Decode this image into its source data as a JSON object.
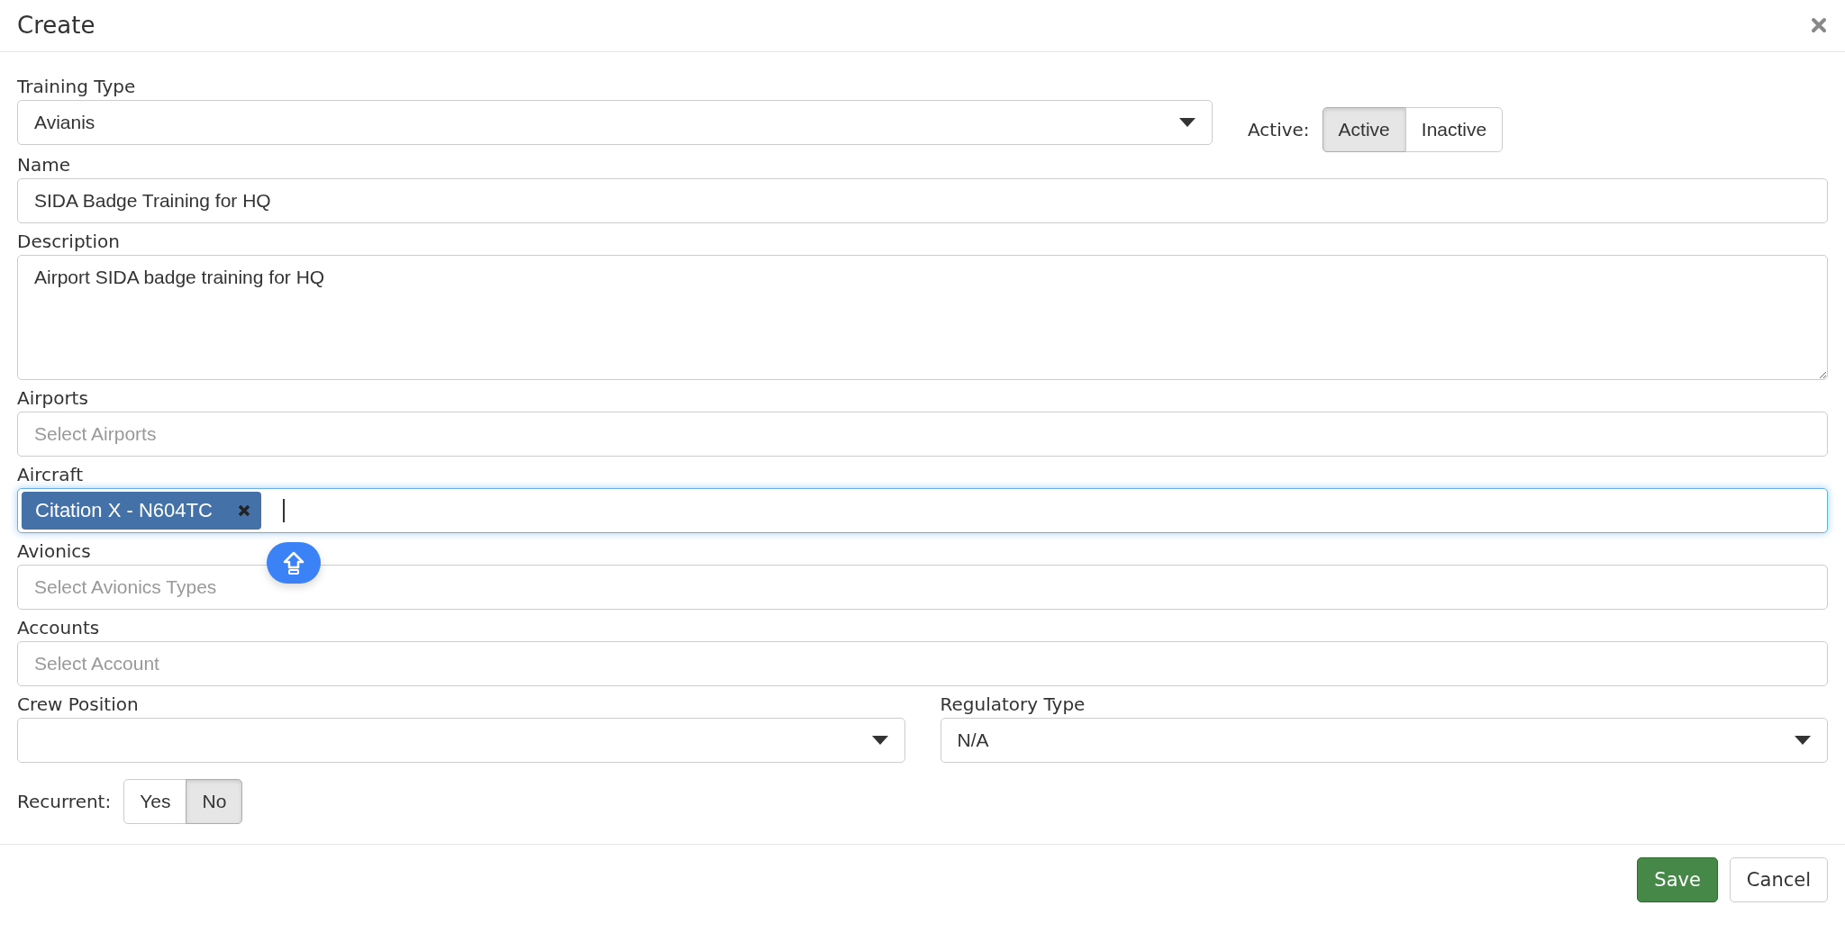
{
  "dialog": {
    "title": "Create"
  },
  "training_type": {
    "label": "Training Type",
    "value": "Avianis"
  },
  "active": {
    "label": "Active:",
    "options": [
      {
        "label": "Active",
        "selected": true
      },
      {
        "label": "Inactive",
        "selected": false
      }
    ]
  },
  "name": {
    "label": "Name",
    "value": "SIDA Badge Training for HQ"
  },
  "description": {
    "label": "Description",
    "value": "Airport SIDA badge training for HQ"
  },
  "airports": {
    "label": "Airports",
    "placeholder": "Select Airports"
  },
  "aircraft": {
    "label": "Aircraft",
    "focused": true,
    "tags": [
      {
        "label": "Citation X - N604TC"
      }
    ]
  },
  "avionics": {
    "label": "Avionics",
    "placeholder": "Select Avionics Types"
  },
  "accounts": {
    "label": "Accounts",
    "placeholder": "Select Account"
  },
  "crew_position": {
    "label": "Crew Position"
  },
  "regulatory_type": {
    "label": "Regulatory Type",
    "value": "N/A"
  },
  "recurrent": {
    "label": "Recurrent:",
    "options": [
      {
        "label": "Yes",
        "selected": false
      },
      {
        "label": "No",
        "selected": true
      }
    ]
  },
  "buttons": [
    {
      "label": "Save",
      "kind": "primary"
    },
    {
      "label": "Cancel",
      "kind": "default"
    }
  ]
}
